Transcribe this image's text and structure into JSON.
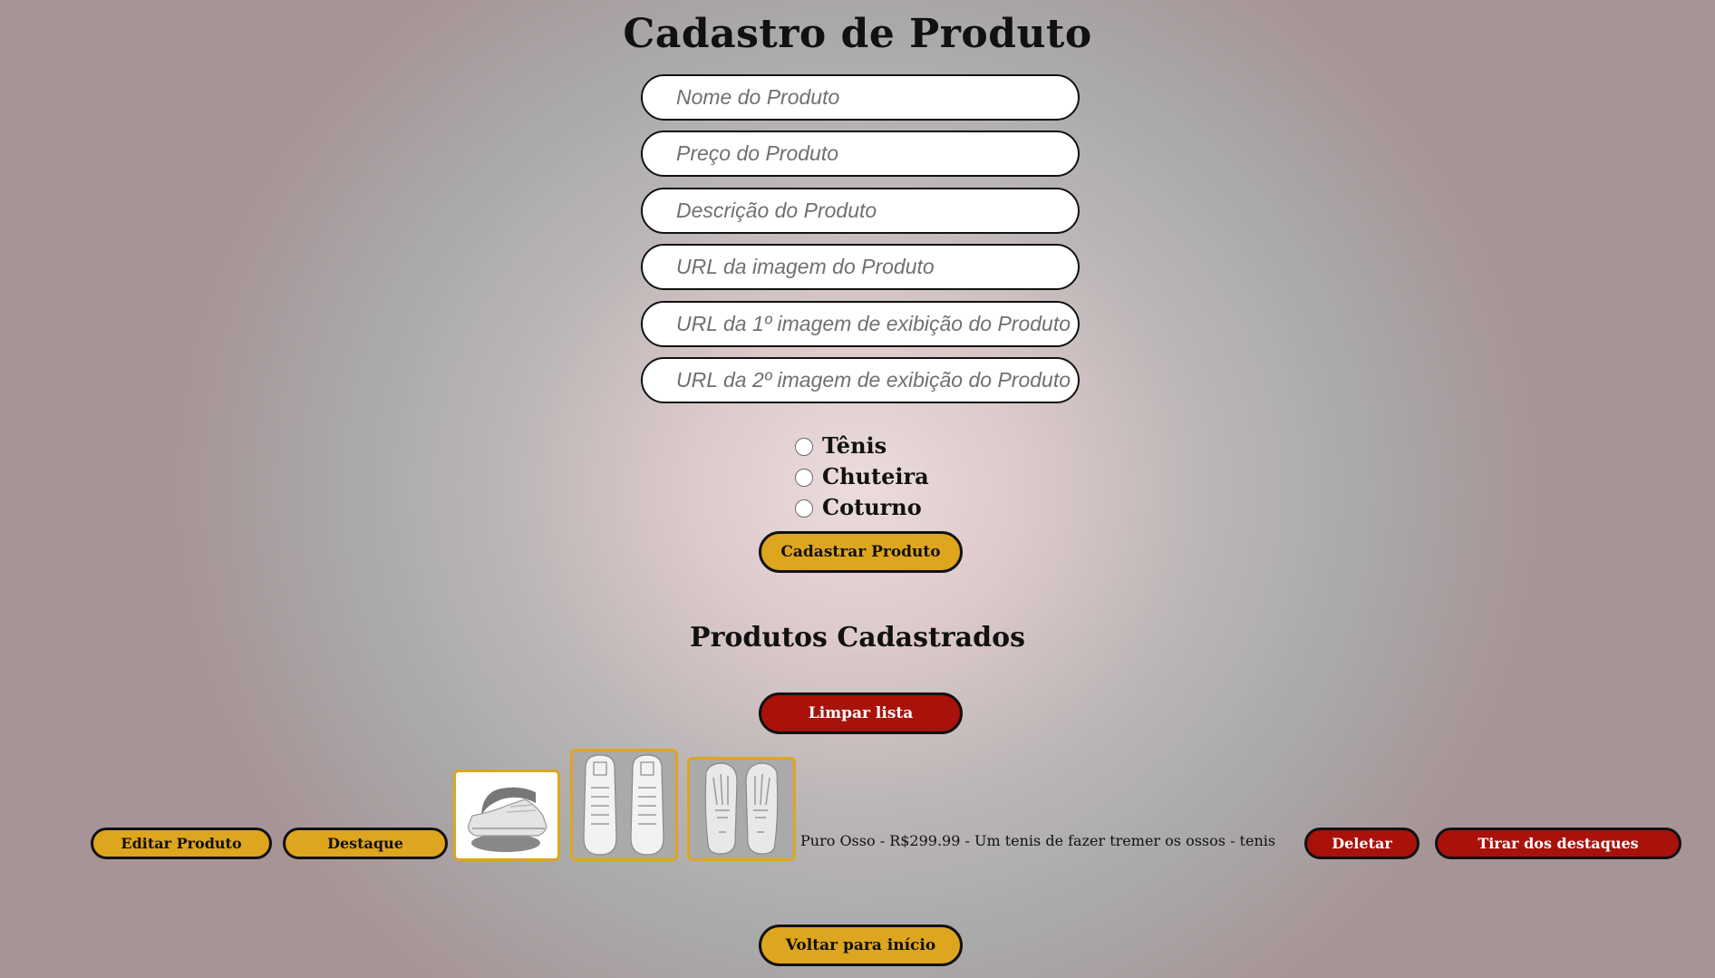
{
  "page": {
    "title": "Cadastro de Produto",
    "list_title": "Produtos Cadastrados"
  },
  "form": {
    "fields": [
      {
        "placeholder": "Nome do Produto",
        "value": ""
      },
      {
        "placeholder": "Preço do Produto",
        "value": ""
      },
      {
        "placeholder": "Descrição do Produto",
        "value": ""
      },
      {
        "placeholder": "URL da imagem do Produto",
        "value": ""
      },
      {
        "placeholder": "URL da 1º imagem de exibição do Produto",
        "value": ""
      },
      {
        "placeholder": "URL da 2º imagem de exibição do Produto",
        "value": ""
      }
    ],
    "categories": [
      {
        "label": "Tênis",
        "checked": false
      },
      {
        "label": "Chuteira",
        "checked": false
      },
      {
        "label": "Coturno",
        "checked": false
      }
    ],
    "submit_label": "Cadastrar Produto"
  },
  "list": {
    "clear_label": "Limpar lista",
    "items": [
      {
        "edit_label": "Editar Produto",
        "highlight_label": "Destaque",
        "summary": "Puro Osso - R$299.99 - Um tenis de fazer tremer os ossos - tenis",
        "delete_label": "Deletar",
        "unhighlight_label": "Tirar dos destaques",
        "images": [
          "sneaker-side-image",
          "sneaker-top-image",
          "sneaker-sole-image"
        ]
      }
    ]
  },
  "footer": {
    "back_label": "Voltar para início"
  },
  "colors": {
    "gold": "#dea51f",
    "red": "#a8120b",
    "thumb_border": "#dea51f"
  }
}
